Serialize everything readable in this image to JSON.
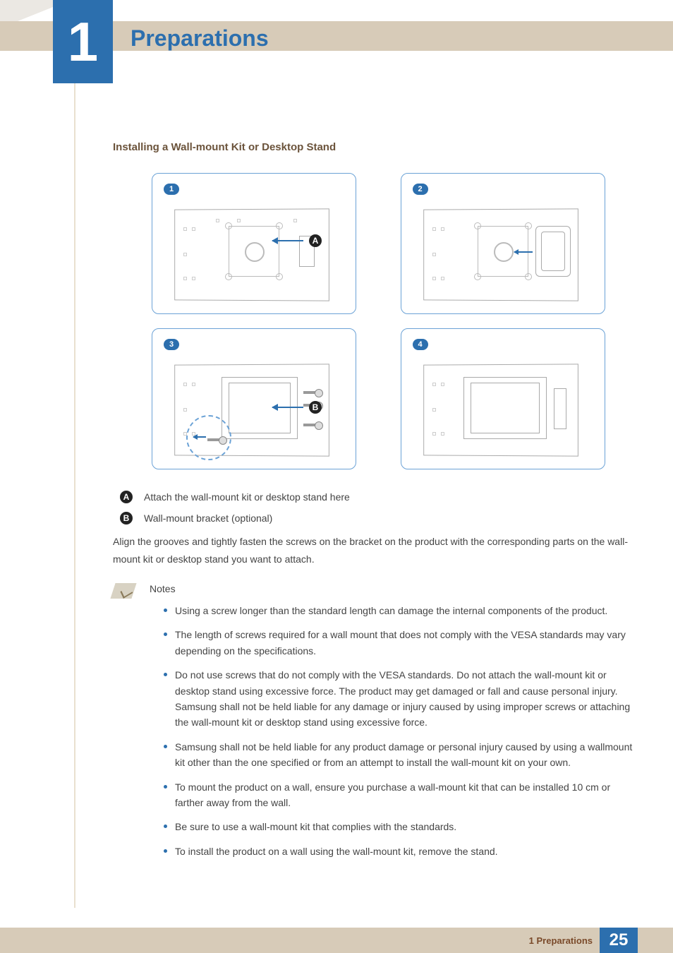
{
  "chapter": {
    "number": "1",
    "title": "Preparations"
  },
  "section": {
    "heading": "Installing a Wall-mount Kit or Desktop Stand"
  },
  "steps": {
    "s1": "1",
    "s2": "2",
    "s3": "3",
    "s4": "4"
  },
  "callouts": {
    "a": "A",
    "b": "B"
  },
  "legend": {
    "a": "Attach the wall-mount kit or desktop stand here",
    "b": "Wall-mount bracket (optional)"
  },
  "body": "Align the grooves and tightly fasten the screws on the bracket on the product with the corresponding parts on the wall-mount kit or desktop stand you want to attach.",
  "notes_title": "Notes",
  "notes": [
    "Using a screw longer than the standard length can damage the internal components of the product.",
    "The length of screws required for a wall mount that does not comply with the VESA standards may vary depending on the specifications.",
    "Do not use screws that do not comply with the VESA standards. Do not attach the wall-mount kit or desktop stand using excessive force. The product may get damaged or fall and cause personal injury. Samsung shall not be held liable for any damage or injury caused by using improper screws or attaching the wall-mount kit or desktop stand using excessive force.",
    "Samsung shall not be held liable for any product damage or personal injury caused by using a wallmount kit other than the one specified or from an attempt to install the wall-mount kit on your own.",
    "To mount the product on a wall, ensure you purchase a wall-mount kit that can be installed 10 cm or farther away from the wall.",
    "Be sure to use a wall-mount kit that complies with the standards.",
    "To install the product on a wall using the wall-mount kit, remove the stand."
  ],
  "footer": {
    "label": "1 Preparations",
    "page": "25"
  }
}
